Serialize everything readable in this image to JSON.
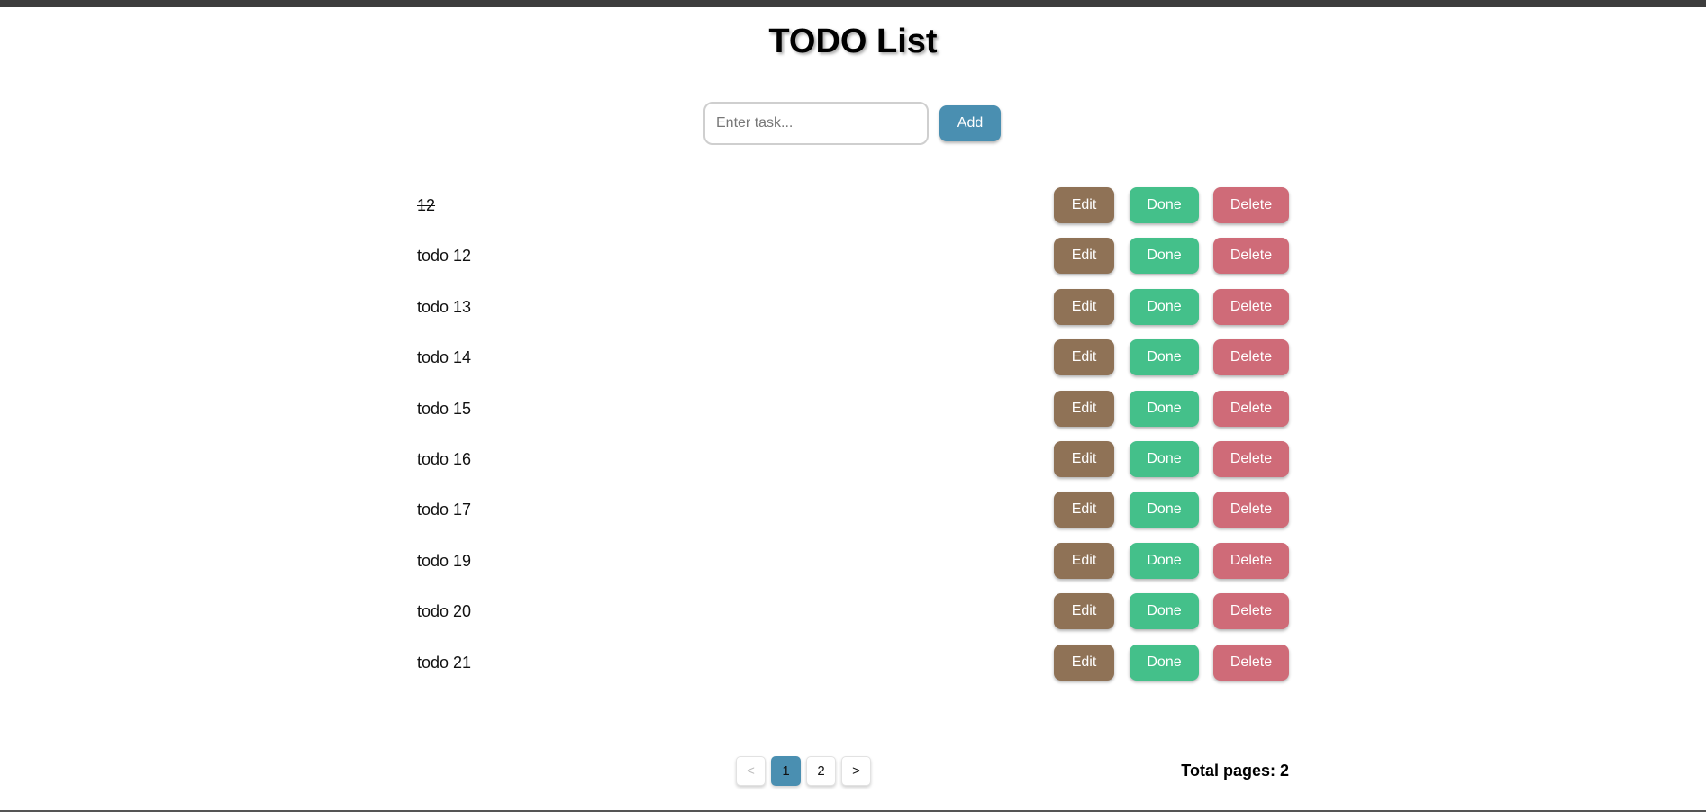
{
  "title": "TODO List",
  "form": {
    "placeholder": "Enter task...",
    "value": "",
    "add_label": "Add"
  },
  "todos": [
    {
      "text": "12",
      "done": true,
      "edit_label": "Edit",
      "done_label": "Done",
      "delete_label": "Delete"
    },
    {
      "text": "todo 12",
      "done": false,
      "edit_label": "Edit",
      "done_label": "Done",
      "delete_label": "Delete"
    },
    {
      "text": "todo 13",
      "done": false,
      "edit_label": "Edit",
      "done_label": "Done",
      "delete_label": "Delete"
    },
    {
      "text": "todo 14",
      "done": false,
      "edit_label": "Edit",
      "done_label": "Done",
      "delete_label": "Delete"
    },
    {
      "text": "todo 15",
      "done": false,
      "edit_label": "Edit",
      "done_label": "Done",
      "delete_label": "Delete"
    },
    {
      "text": "todo 16",
      "done": false,
      "edit_label": "Edit",
      "done_label": "Done",
      "delete_label": "Delete"
    },
    {
      "text": "todo 17",
      "done": false,
      "edit_label": "Edit",
      "done_label": "Done",
      "delete_label": "Delete"
    },
    {
      "text": "todo 19",
      "done": false,
      "edit_label": "Edit",
      "done_label": "Done",
      "delete_label": "Delete"
    },
    {
      "text": "todo 20",
      "done": false,
      "edit_label": "Edit",
      "done_label": "Done",
      "delete_label": "Delete"
    },
    {
      "text": "todo 21",
      "done": false,
      "edit_label": "Edit",
      "done_label": "Done",
      "delete_label": "Delete"
    }
  ],
  "pagination": {
    "prev_label": "<",
    "pages": [
      "1",
      "2"
    ],
    "current_page": "1",
    "next_label": ">",
    "total_label": "Total pages: 2"
  },
  "colors": {
    "accent": "#4a8fb1",
    "edit": "#8f7256",
    "done": "#44c08a",
    "delete": "#cf6b78"
  }
}
